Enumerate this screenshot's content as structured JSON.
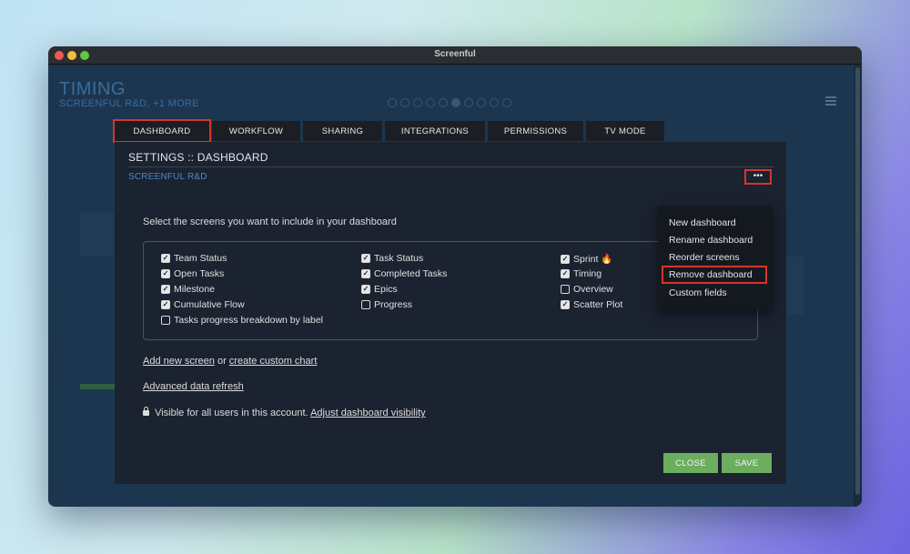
{
  "window": {
    "title": "Screenful"
  },
  "app": {
    "title": "TIMING",
    "subtitle": "SCREENFUL R&D, +1 MORE",
    "page_indicator": {
      "total": 10,
      "active": 5
    }
  },
  "tabs": [
    {
      "id": "dashboard",
      "label": "DASHBOARD",
      "active": true
    },
    {
      "id": "workflow",
      "label": "WORKFLOW",
      "active": false
    },
    {
      "id": "sharing",
      "label": "SHARING",
      "active": false
    },
    {
      "id": "integrations",
      "label": "INTEGRATIONS",
      "active": false
    },
    {
      "id": "permissions",
      "label": "PERMISSIONS",
      "active": false
    },
    {
      "id": "tv-mode",
      "label": "TV MODE",
      "active": false
    }
  ],
  "modal": {
    "title": "SETTINGS :: DASHBOARD",
    "subtitle": "SCREENFUL R&D",
    "more_label": "•••",
    "close_label": "✖",
    "instruction": "Select the screens you want to include in your dashboard",
    "screens": [
      {
        "label": "Team Status",
        "checked": true
      },
      {
        "label": "Open Tasks",
        "checked": true
      },
      {
        "label": "Milestone",
        "checked": true
      },
      {
        "label": "Cumulative Flow",
        "checked": true
      },
      {
        "label": "Tasks progress breakdown by label",
        "checked": false
      },
      {
        "label": "Task Status",
        "checked": true
      },
      {
        "label": "Completed Tasks",
        "checked": true
      },
      {
        "label": "Epics",
        "checked": true
      },
      {
        "label": "Progress",
        "checked": false
      },
      {
        "label": "Sprint 🔥",
        "checked": true
      },
      {
        "label": "Timing",
        "checked": true
      },
      {
        "label": "Overview",
        "checked": false
      },
      {
        "label": "Scatter Plot",
        "checked": true
      }
    ],
    "add_screen_link": "Add new screen",
    "or_text": "or",
    "custom_chart_link": "create custom chart",
    "advanced_refresh_link": "Advanced data refresh",
    "visibility_text": "Visible for all users in this account.",
    "visibility_link": "Adjust dashboard visibility",
    "close_button": "CLOSE",
    "save_button": "SAVE"
  },
  "menu": {
    "items": [
      {
        "label": "New dashboard",
        "highlighted": false
      },
      {
        "label": "Rename dashboard",
        "highlighted": false
      },
      {
        "label": "Reorder screens",
        "highlighted": false
      },
      {
        "label": "Remove dashboard",
        "highlighted": true
      },
      {
        "label": "Custom fields",
        "highlighted": false
      }
    ]
  },
  "colors": {
    "accent_green": "#6cad60",
    "highlight_red": "#d5352b",
    "link_blue": "#4f86c6"
  }
}
